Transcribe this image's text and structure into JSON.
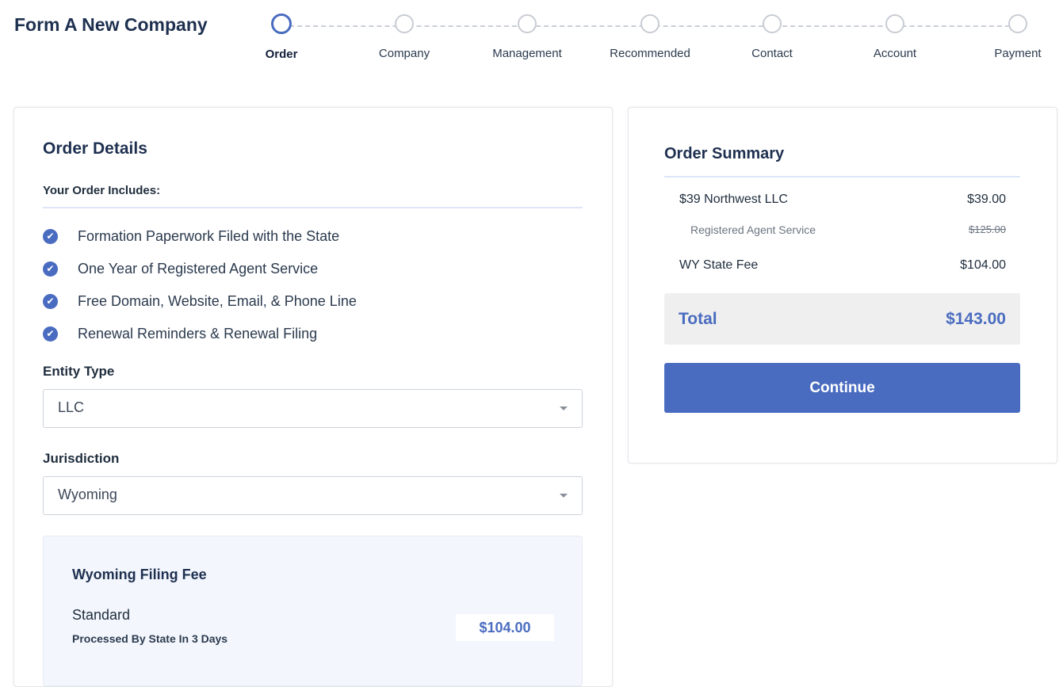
{
  "header": {
    "title": "Form A New Company"
  },
  "steps": [
    {
      "label": "Order",
      "active": true
    },
    {
      "label": "Company",
      "active": false
    },
    {
      "label": "Management",
      "active": false
    },
    {
      "label": "Recommended",
      "active": false
    },
    {
      "label": "Contact",
      "active": false
    },
    {
      "label": "Account",
      "active": false
    },
    {
      "label": "Payment",
      "active": false
    }
  ],
  "order_details": {
    "title": "Order Details",
    "includes_label": "Your Order Includes:",
    "includes": [
      "Formation Paperwork Filed with the State",
      "One Year of Registered Agent Service",
      "Free Domain, Website, Email, & Phone Line",
      "Renewal Reminders & Renewal Filing"
    ],
    "entity_type": {
      "label": "Entity Type",
      "value": "LLC"
    },
    "jurisdiction": {
      "label": "Jurisdiction",
      "value": "Wyoming"
    },
    "filing_fee": {
      "title": "Wyoming Filing Fee",
      "option": "Standard",
      "description": "Processed By State In 3 Days",
      "price": "$104.00"
    }
  },
  "order_summary": {
    "title": "Order Summary",
    "items": [
      {
        "label": "$39 Northwest LLC",
        "amount": "$39.00"
      },
      {
        "label": "Registered Agent Service",
        "amount": "$125.00"
      },
      {
        "label": "WY State Fee",
        "amount": "$104.00"
      }
    ],
    "total_label": "Total",
    "total_amount": "$143.00",
    "continue_label": "Continue"
  },
  "colors": {
    "accent": "#4a6cc0",
    "title": "#1e3050",
    "summary_bg": "#efefef",
    "fee_box_bg": "#f3f6fc"
  },
  "icons": {
    "check": "check-circle-icon",
    "caret": "caret-down-icon"
  }
}
